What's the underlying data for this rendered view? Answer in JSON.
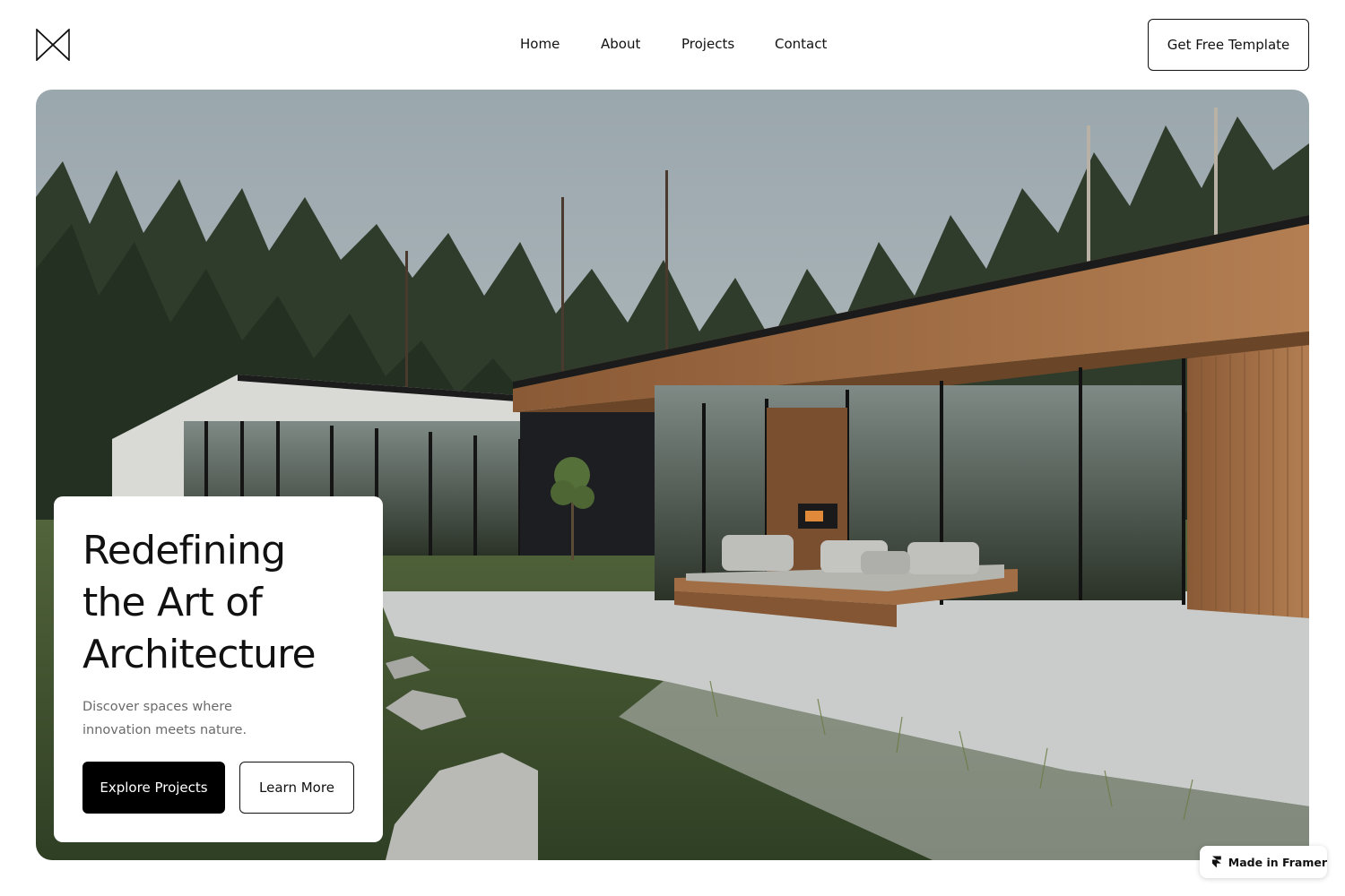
{
  "header": {
    "logo_icon": "bowtie-logo-icon",
    "nav": [
      "Home",
      "About",
      "Projects",
      "Contact"
    ],
    "cta_label": "Get Free Template"
  },
  "hero": {
    "image_subject": "modern-house-in-forest-image",
    "card": {
      "title_lines": [
        "Redefining",
        "the Art of",
        "Architecture"
      ],
      "subtitle_lines": [
        "Discover spaces where",
        "innovation meets nature."
      ],
      "primary_button": "Explore Projects",
      "secondary_button": "Learn More"
    }
  },
  "badge": {
    "icon": "framer-icon",
    "label": "Made in Framer"
  },
  "colors": {
    "text": "#111111",
    "muted": "#6a6a6a",
    "primary_button": "#000000",
    "wood": "#a9744a",
    "grass": "#3f5230",
    "sky": "#aeb8be"
  }
}
